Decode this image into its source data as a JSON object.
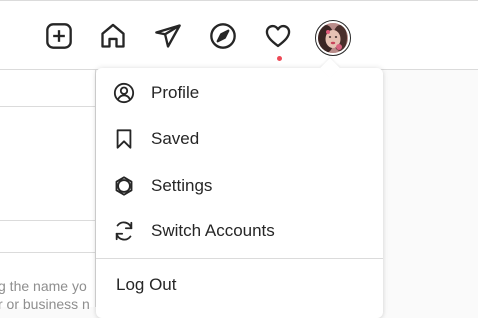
{
  "navbar": {
    "icons": [
      "new-post-icon",
      "home-icon",
      "direct-messages-icon",
      "explore-icon",
      "activity-heart-icon"
    ],
    "notification_dot_color": "#ed4956",
    "avatar": "profile-avatar"
  },
  "background": {
    "text_lines": [
      "g the name yo",
      "r or business n"
    ]
  },
  "menu": {
    "items": [
      {
        "label": "Profile",
        "icon": "profile-icon"
      },
      {
        "label": "Saved",
        "icon": "bookmark-icon"
      },
      {
        "label": "Settings",
        "icon": "settings-icon"
      },
      {
        "label": "Switch Accounts",
        "icon": "switch-accounts-icon"
      }
    ],
    "logout_label": "Log Out"
  }
}
